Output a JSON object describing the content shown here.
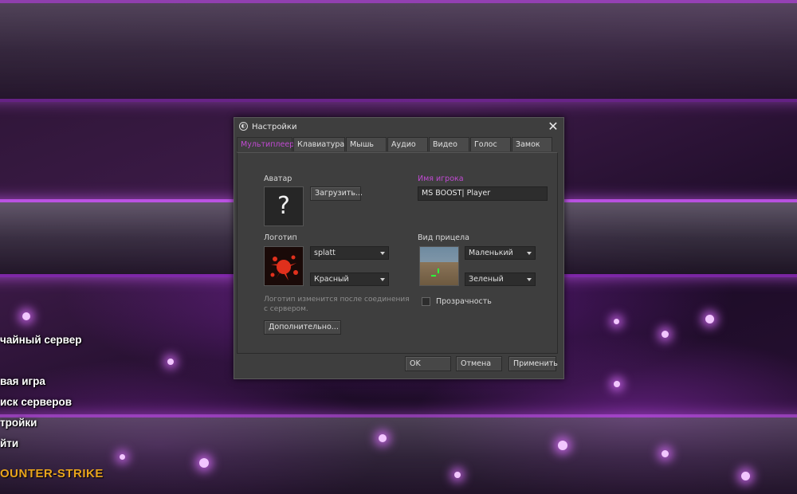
{
  "menu": {
    "items": [
      {
        "label": "чайный сервер"
      },
      {
        "label": "вая игра"
      },
      {
        "label": "иск серверов"
      },
      {
        "label": "тройки"
      },
      {
        "label": "йти"
      }
    ],
    "logo": "OUNTER-STRIKE"
  },
  "dialog": {
    "title": "Настройки",
    "tabs": [
      {
        "label": "Мультиплеер",
        "active": true
      },
      {
        "label": "Клавиатура"
      },
      {
        "label": "Мышь"
      },
      {
        "label": "Аудио"
      },
      {
        "label": "Видео"
      },
      {
        "label": "Голос"
      },
      {
        "label": "Замок"
      }
    ],
    "avatar": {
      "label": "Аватар",
      "placeholder_glyph": "?",
      "upload_button": "Загрузить..."
    },
    "player_name": {
      "label": "Имя игрока",
      "value": "MS BOOST| Player"
    },
    "logo": {
      "label": "Логотип",
      "image_select": "splatt",
      "color_select": "Красный"
    },
    "crosshair": {
      "label": "Вид прицела",
      "size_select": "Маленький",
      "color_select": "Зеленый",
      "transparency_label": "Прозрачность",
      "transparency_checked": false
    },
    "note": "Логотип изменится после соединения с сервером.",
    "advanced_button": "Дополнительно...",
    "footer": {
      "ok": "OK",
      "cancel": "Отмена",
      "apply": "Применить"
    },
    "accent_color": "#c04ad2"
  }
}
